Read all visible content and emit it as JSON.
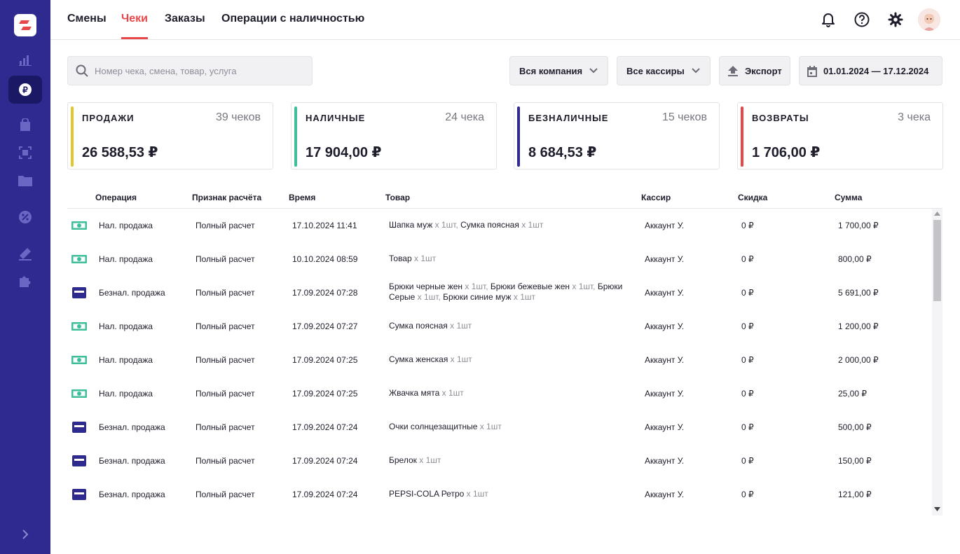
{
  "colors": {
    "sidebar": "#2e2a8f",
    "accent": "#e8474a",
    "sales": "#e1c62c",
    "cash": "#3fbe9b",
    "cashless": "#2e2a8f",
    "returns": "#e8474a"
  },
  "tabs": [
    {
      "label": "Смены"
    },
    {
      "label": "Чеки"
    },
    {
      "label": "Заказы"
    },
    {
      "label": "Операции с наличностью"
    }
  ],
  "search": {
    "placeholder": "Номер чека, смена, товар, услуга",
    "value": ""
  },
  "filters": {
    "company": "Вся компания",
    "cashiers": "Все кассиры",
    "export": "Экспорт",
    "date_range": "01.01.2024 — 17.12.2024"
  },
  "cards": [
    {
      "label": "ПРОДАЖИ",
      "count": "39 чеков",
      "amount": "26 588,53 ₽"
    },
    {
      "label": "НАЛИЧНЫЕ",
      "count": "24 чека",
      "amount": "17 904,00 ₽"
    },
    {
      "label": "БЕЗНАЛИЧНЫЕ",
      "count": "15 чеков",
      "amount": "8 684,53 ₽"
    },
    {
      "label": "ВОЗВРАТЫ",
      "count": "3 чека",
      "amount": "1 706,00 ₽"
    }
  ],
  "columns": {
    "operation": "Операция",
    "sign": "Признак расчёта",
    "time": "Время",
    "goods": "Товар",
    "cashier": "Кассир",
    "discount": "Скидка",
    "sum": "Сумма"
  },
  "rows": [
    {
      "type": "cash",
      "operation": "Нал. продажа",
      "sign": "Полный расчет",
      "time": "17.10.2024 11:41",
      "goods": [
        {
          "name": "Шапка муж",
          "qty": "x 1шт"
        },
        {
          "name": "Сумка поясная",
          "qty": "x 1шт"
        }
      ],
      "cashier": "Аккаунт У.",
      "discount": "0 ₽",
      "sum": "1 700,00 ₽"
    },
    {
      "type": "cash",
      "operation": "Нал. продажа",
      "sign": "Полный расчет",
      "time": "10.10.2024 08:59",
      "goods": [
        {
          "name": "Товар",
          "qty": "x 1шт"
        }
      ],
      "cashier": "Аккаунт У.",
      "discount": "0 ₽",
      "sum": "800,00 ₽"
    },
    {
      "type": "card",
      "operation": "Безнал. продажа",
      "sign": "Полный расчет",
      "time": "17.09.2024 07:28",
      "goods": [
        {
          "name": "Брюки черные жен",
          "qty": "x 1шт"
        },
        {
          "name": "Брюки бежевые жен",
          "qty": "x 1шт"
        },
        {
          "name": "Брюки Серые",
          "qty": "x 1шт"
        },
        {
          "name": "Брюки синие муж",
          "qty": "x 1шт"
        }
      ],
      "cashier": "Аккаунт У.",
      "discount": "0 ₽",
      "sum": "5 691,00 ₽"
    },
    {
      "type": "cash",
      "operation": "Нал. продажа",
      "sign": "Полный расчет",
      "time": "17.09.2024 07:27",
      "goods": [
        {
          "name": "Сумка поясная",
          "qty": "x 1шт"
        }
      ],
      "cashier": "Аккаунт У.",
      "discount": "0 ₽",
      "sum": "1 200,00 ₽"
    },
    {
      "type": "cash",
      "operation": "Нал. продажа",
      "sign": "Полный расчет",
      "time": "17.09.2024 07:25",
      "goods": [
        {
          "name": "Сумка женская",
          "qty": "x 1шт"
        }
      ],
      "cashier": "Аккаунт У.",
      "discount": "0 ₽",
      "sum": "2 000,00 ₽"
    },
    {
      "type": "cash",
      "operation": "Нал. продажа",
      "sign": "Полный расчет",
      "time": "17.09.2024 07:25",
      "goods": [
        {
          "name": "Жвачка мята",
          "qty": "x 1шт"
        }
      ],
      "cashier": "Аккаунт У.",
      "discount": "0 ₽",
      "sum": "25,00 ₽"
    },
    {
      "type": "card",
      "operation": "Безнал. продажа",
      "sign": "Полный расчет",
      "time": "17.09.2024 07:24",
      "goods": [
        {
          "name": "Очки солнцезащитные",
          "qty": "x 1шт"
        }
      ],
      "cashier": "Аккаунт У.",
      "discount": "0 ₽",
      "sum": "500,00 ₽"
    },
    {
      "type": "card",
      "operation": "Безнал. продажа",
      "sign": "Полный расчет",
      "time": "17.09.2024 07:24",
      "goods": [
        {
          "name": "Брелок",
          "qty": "x 1шт"
        }
      ],
      "cashier": "Аккаунт У.",
      "discount": "0 ₽",
      "sum": "150,00 ₽"
    },
    {
      "type": "card",
      "operation": "Безнал. продажа",
      "sign": "Полный расчет",
      "time": "17.09.2024 07:24",
      "goods": [
        {
          "name": "PEPSI-COLA Ретро",
          "qty": "x 1шт"
        }
      ],
      "cashier": "Аккаунт У.",
      "discount": "0 ₽",
      "sum": "121,00 ₽"
    }
  ]
}
